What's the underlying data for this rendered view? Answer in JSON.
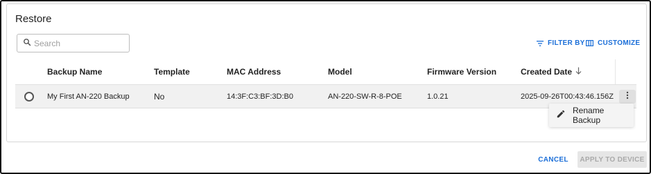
{
  "dialog": {
    "title": "Restore"
  },
  "search": {
    "placeholder": "Search",
    "value": ""
  },
  "toolbar": {
    "filter_label": "FILTER BY",
    "customize_label": "CUSTOMIZE"
  },
  "table": {
    "columns": [
      "Backup Name",
      "Template",
      "MAC Address",
      "Model",
      "Firmware Version",
      "Created Date"
    ],
    "sort_column": "Created Date",
    "sort_direction": "descending",
    "rows": [
      {
        "selected": false,
        "backup_name": "My First AN-220 Backup",
        "template": "No",
        "mac_address": "14:3F:C3:BF:3D:B0",
        "model": "AN-220-SW-R-8-POE",
        "firmware_version": "1.0.21",
        "created_date": "2025-09-26T00:43:46.156Z"
      }
    ]
  },
  "row_menu": {
    "items": [
      {
        "label": "Rename Backup",
        "icon": "pencil-icon"
      }
    ]
  },
  "footer": {
    "cancel_label": "CANCEL",
    "apply_label": "APPLY TO DEVICE",
    "apply_enabled": false
  },
  "colors": {
    "accent": "#1a6ed8",
    "row_bg": "#f1f1f1",
    "disabled_bg": "#e6e6e6"
  }
}
